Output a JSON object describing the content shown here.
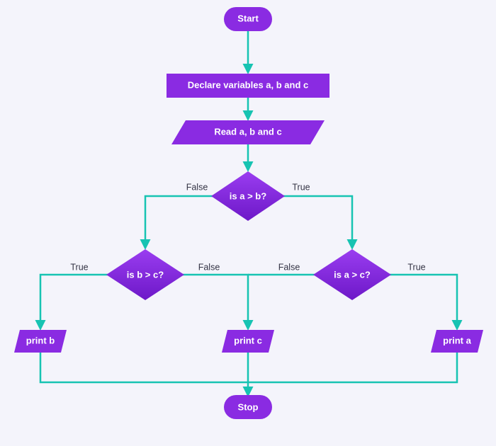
{
  "colors": {
    "accent": "#8a2be2",
    "accentGradTop": "#9a3df0",
    "accentGradBottom": "#6d18c8",
    "connector": "#17c3b2",
    "background": "#f4f4fb",
    "shapeText": "#ffffff",
    "edgeText": "#333344"
  },
  "nodes": {
    "start": "Start",
    "declare": "Declare variables a, b and c",
    "read": "Read a, b and c",
    "dec1": "is a > b?",
    "dec2": "is b > c?",
    "dec3": "is a > c?",
    "printA": "print a",
    "printB": "print b",
    "printC": "print c",
    "stop": "Stop"
  },
  "edgeLabels": {
    "trueLabel": "True",
    "falseLabel": "False"
  }
}
